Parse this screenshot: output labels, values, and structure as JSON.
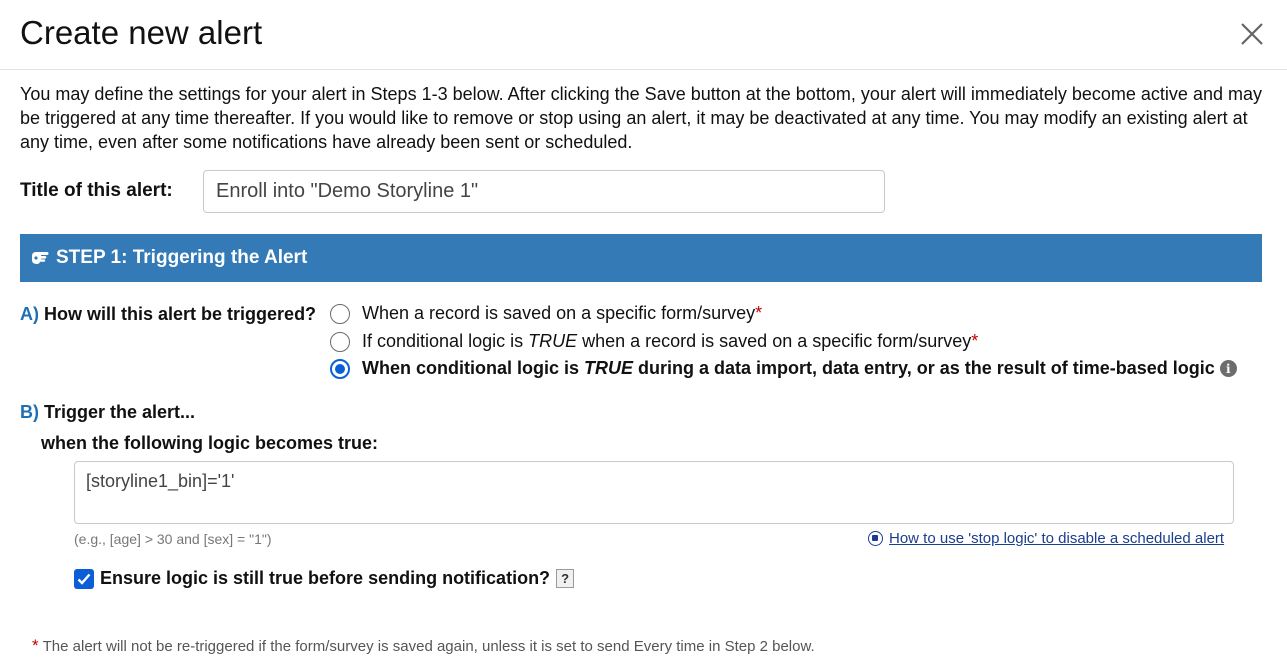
{
  "dialog": {
    "title": "Create new alert",
    "intro": "You may define the settings for your alert in Steps 1-3 below. After clicking the Save button at the bottom, your alert will immediately become active and may be triggered at any time thereafter. If you would like to remove or stop using an alert, it may be deactivated at any time. You may modify an existing alert at any time, even after some notifications have already been sent or scheduled."
  },
  "alert_title": {
    "label": "Title of this alert:",
    "value": "Enroll into \"Demo Storyline 1\""
  },
  "step1": {
    "header": "STEP 1: Triggering the Alert",
    "section_a": {
      "letter": "A)",
      "question": "How will this alert be triggered?",
      "options": [
        {
          "pre": "When a record is saved on a specific form/survey",
          "em": "",
          "post": "",
          "required": "*",
          "checked": false
        },
        {
          "pre": "If conditional logic is ",
          "em": "TRUE",
          "post": " when a record is saved on a specific form/survey",
          "required": "*",
          "checked": false
        },
        {
          "pre": "When conditional logic is ",
          "em": "TRUE",
          "post": " during a data import, data entry, or as the result of time-based logic",
          "required": "",
          "checked": true
        }
      ]
    },
    "section_b": {
      "letter": "B)",
      "label": "Trigger the alert...",
      "sub_label": "when the following logic becomes true:",
      "logic_value": "[storyline1_bin]='1'",
      "example": "(e.g., [age] > 30 and [sex] = \"1\")",
      "help_link": "How to use 'stop logic' to disable a scheduled alert",
      "ensure_label": "Ensure logic is still true before sending notification?",
      "ensure_checked": true,
      "help_qmark": "?"
    },
    "footnote_star": "*",
    "footnote": "The alert will not be re-triggered if the form/survey is saved again, unless it is set to send Every time in Step 2 below."
  },
  "colors": {
    "step_header_bg": "#337ab7",
    "accent_blue": "#0b5fd6",
    "required_red": "#c00000",
    "link": "#1a3e8c"
  }
}
